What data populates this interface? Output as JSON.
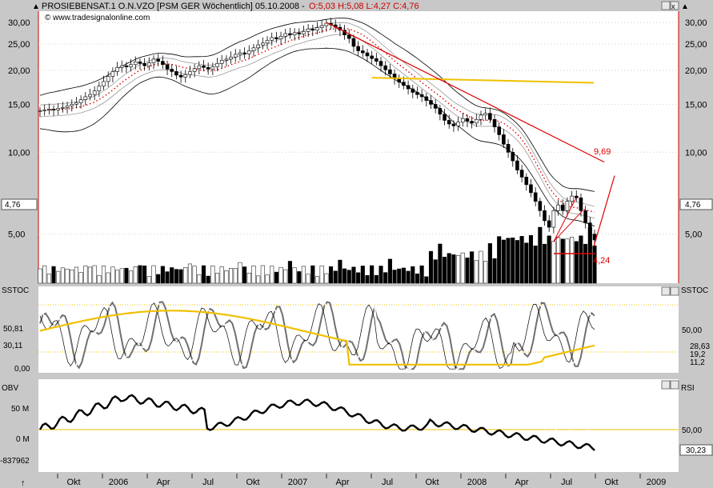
{
  "header": {
    "title_prefix": "PROSIEBENSAT.1 O.N.VZO [PSM GER  Wöchentlich] 05.10.2008 - ",
    "ohlc": "O:5,03 H:5,08 L:4,27 C:4,76",
    "watermark": "www.tradesignalonline.com"
  },
  "colors": {
    "background": "#c8c8c8",
    "panel": "#ffffff",
    "price_axis_line": "#d00000",
    "trend": "#e00000",
    "ma": "#f0c000",
    "sma_dotted": "#e00000",
    "bollinger": "#000000",
    "bollinger_inner": "#ffffff"
  },
  "panels": {
    "sstoc": {
      "label": "SSTOC",
      "right_label": "SSTOC"
    },
    "obv": {
      "label": "OBV",
      "right_label": "RSI"
    }
  },
  "chart_data": [
    {
      "type": "candlestick",
      "title": "PROSIEBENSAT.1 O.N.VZO [PSM GER  Wöchentlich] 05.10.2008",
      "scale": "log",
      "ylim": [
        3.3,
        33
      ],
      "y_ticks": [
        "30,00",
        "25,00",
        "20,00",
        "15,00",
        "10,00",
        "5,00"
      ],
      "y_tick_values": [
        30,
        25,
        20,
        15,
        10,
        5
      ],
      "x_tick_labels": [
        "Okt",
        "2006",
        "Apr",
        "Jul",
        "Okt",
        "2007",
        "Apr",
        "Jul",
        "Okt",
        "2008",
        "Apr",
        "Jul",
        "Okt",
        "2009"
      ],
      "last_price_label": "4,76",
      "last_price": 4.76,
      "annotations": [
        {
          "text": "9,69",
          "value": 9.69
        },
        {
          "text": "4,24",
          "value": 4.24
        }
      ],
      "series_close": [
        14.2,
        14.3,
        14.4,
        14.3,
        14.5,
        14.6,
        14.8,
        15.0,
        15.2,
        15.6,
        16.0,
        16.3,
        16.8,
        17.5,
        18.2,
        19.0,
        19.8,
        20.5,
        20.8,
        20.6,
        21.0,
        21.5,
        21.2,
        20.8,
        21.3,
        22.0,
        21.6,
        21.0,
        20.2,
        19.8,
        19.2,
        18.9,
        19.3,
        19.8,
        20.3,
        20.8,
        20.5,
        20.2,
        20.6,
        21.2,
        21.8,
        22.0,
        22.4,
        22.9,
        23.2,
        23.0,
        23.6,
        24.2,
        24.8,
        25.2,
        25.8,
        26.4,
        26.1,
        26.7,
        27.3,
        27.0,
        27.5,
        27.2,
        27.8,
        28.4,
        28.1,
        28.7,
        29.2,
        29.8,
        29.4,
        28.8,
        28.1,
        27.0,
        26.2,
        24.5,
        23.6,
        23.2,
        22.6,
        22.1,
        21.6,
        20.8,
        20.1,
        19.4,
        18.6,
        18.1,
        17.6,
        17.1,
        16.6,
        16.3,
        16.0,
        15.5,
        15.0,
        14.5,
        13.8,
        13.1,
        12.7,
        12.5,
        12.9,
        13.3,
        13.0,
        12.8,
        13.2,
        13.7,
        13.9,
        13.2,
        12.4,
        11.6,
        10.7,
        10.0,
        9.3,
        8.6,
        8.1,
        7.6,
        7.1,
        6.6,
        6.1,
        5.6,
        5.3,
        6.1,
        6.4,
        6.1,
        6.6,
        6.9,
        6.8,
        6.1,
        5.5,
        5.0,
        4.76
      ]
    },
    {
      "type": "line",
      "title": "SSTOC",
      "y_ticks": [
        "50,81",
        "30,11",
        "0,00"
      ],
      "right_ticks": [
        "50,00",
        "28,63",
        "19,2",
        "11,2"
      ],
      "reference_lines": [
        80,
        20
      ]
    },
    {
      "type": "line",
      "title": "OBV / RSI",
      "y_ticks": [
        "50 M",
        "0 M",
        "-837962"
      ],
      "right_ticks": [
        "50,00",
        "30,23"
      ],
      "reference_line": 0
    }
  ]
}
